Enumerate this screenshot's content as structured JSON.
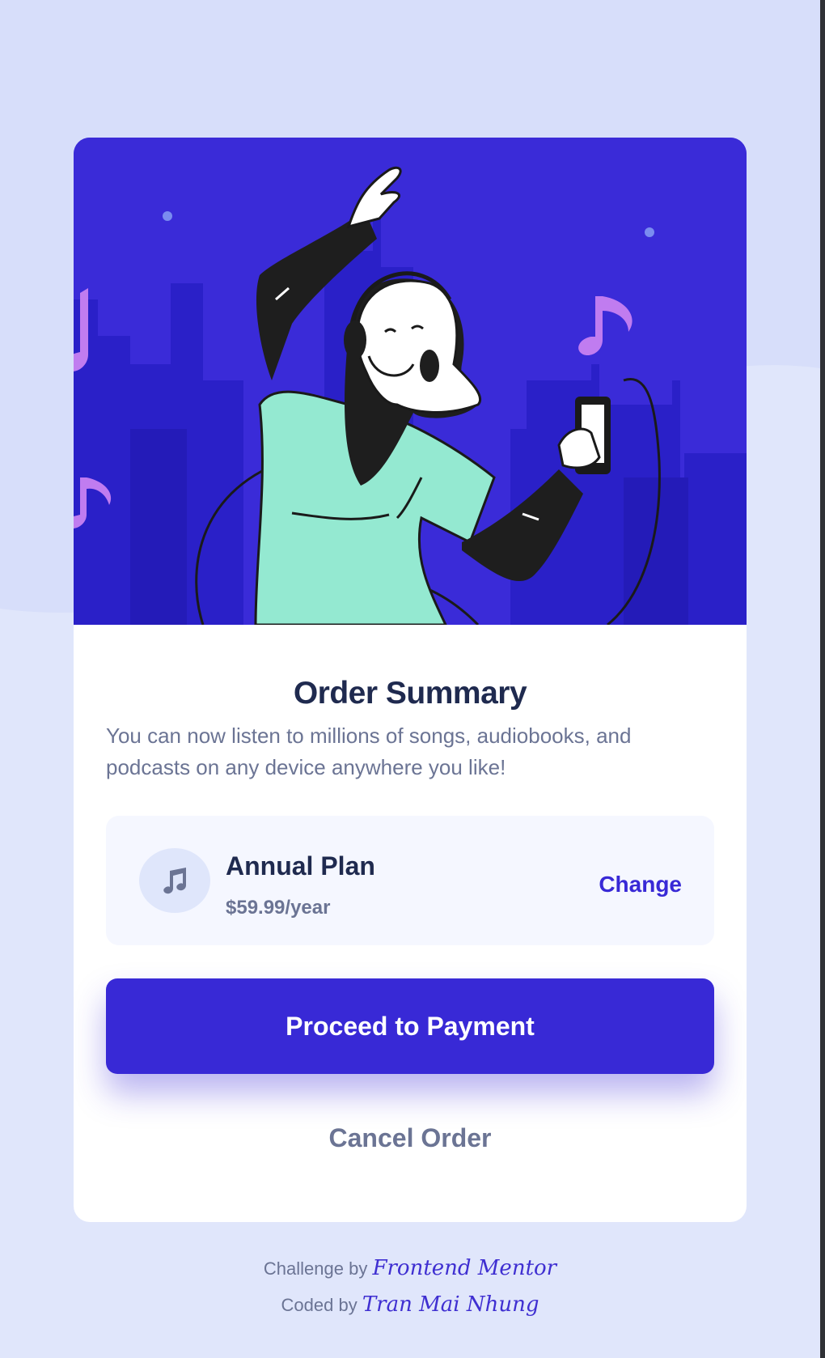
{
  "colors": {
    "page_background": "#e0e6fb",
    "hero_background": "#3a2bd8",
    "primary": "#3829d6",
    "heading": "#1f2a4f",
    "muted": "#6b7494",
    "plan_background": "#f5f7ff"
  },
  "card": {
    "title": "Order Summary",
    "description": "You can now listen to millions of songs, audiobooks, and podcasts on any device anywhere you like!",
    "plan": {
      "icon": "music-note-icon",
      "name": "Annual Plan",
      "price": "$59.99/year",
      "change_label": "Change"
    },
    "proceed_label": "Proceed to Payment",
    "cancel_label": "Cancel Order"
  },
  "attribution": {
    "challenge_prefix": "Challenge by",
    "challenge_link": "Frontend Mentor",
    "coded_prefix": "Coded by",
    "coded_link": "Tran Mai Nhung"
  }
}
